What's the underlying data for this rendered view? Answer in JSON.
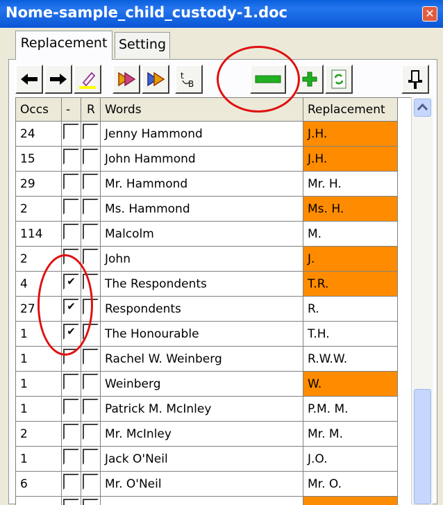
{
  "window": {
    "title": "Nome-sample_child_custody-1.doc",
    "close_glyph": "✕"
  },
  "tabs": [
    {
      "label": "Replacement",
      "active": true
    },
    {
      "label": "Setting",
      "active": false
    }
  ],
  "toolbar": {
    "buttons": [
      {
        "name": "left-arrow-icon"
      },
      {
        "name": "right-arrow-icon"
      },
      {
        "name": "highlighter-icon"
      },
      {
        "name": "replace-all-icon"
      },
      {
        "name": "restore-icon"
      },
      {
        "name": "case-icon"
      },
      {
        "name": "remove-icon"
      },
      {
        "name": "add-icon"
      },
      {
        "name": "refresh-icon"
      },
      {
        "name": "pin-icon"
      }
    ]
  },
  "table": {
    "headers": {
      "occs": "Occs",
      "minus": "-",
      "r": "R",
      "words": "Words",
      "replacement": "Replacement"
    },
    "rows": [
      {
        "occs": "24",
        "minus": false,
        "r": false,
        "word": "Jenny Hammond",
        "replacement": "J.H.",
        "highlight": true
      },
      {
        "occs": "15",
        "minus": false,
        "r": false,
        "word": "John Hammond",
        "replacement": "J.H.",
        "highlight": true
      },
      {
        "occs": "29",
        "minus": false,
        "r": false,
        "word": "Mr. Hammond",
        "replacement": "Mr. H.",
        "highlight": false
      },
      {
        "occs": "2",
        "minus": false,
        "r": false,
        "word": "Ms. Hammond",
        "replacement": "Ms. H.",
        "highlight": true
      },
      {
        "occs": "114",
        "minus": false,
        "r": false,
        "word": "Malcolm",
        "replacement": "M.",
        "highlight": false
      },
      {
        "occs": "2",
        "minus": false,
        "r": false,
        "word": "John",
        "replacement": "J.",
        "highlight": true
      },
      {
        "occs": "4",
        "minus": true,
        "r": false,
        "word": "The Respondents",
        "replacement": "T.R.",
        "highlight": true
      },
      {
        "occs": "27",
        "minus": true,
        "r": false,
        "word": "Respondents",
        "replacement": "R.",
        "highlight": false
      },
      {
        "occs": "1",
        "minus": true,
        "r": false,
        "word": "The Honourable",
        "replacement": "T.H.",
        "highlight": false
      },
      {
        "occs": "1",
        "minus": false,
        "r": false,
        "word": "Rachel W. Weinberg",
        "replacement": "R.W.W.",
        "highlight": false
      },
      {
        "occs": "1",
        "minus": false,
        "r": false,
        "word": "Weinberg",
        "replacement": "W.",
        "highlight": true
      },
      {
        "occs": "1",
        "minus": false,
        "r": false,
        "word": "Patrick M. McInley",
        "replacement": "P.M. M.",
        "highlight": false
      },
      {
        "occs": "2",
        "minus": false,
        "r": false,
        "word": "Mr. McInley",
        "replacement": "Mr. M.",
        "highlight": false
      },
      {
        "occs": "1",
        "minus": false,
        "r": false,
        "word": "Jack O'Neil",
        "replacement": "J.O.",
        "highlight": false
      },
      {
        "occs": "6",
        "minus": false,
        "r": false,
        "word": "Mr. O'Neil",
        "replacement": "Mr. O.",
        "highlight": false
      },
      {
        "occs": "",
        "minus": false,
        "r": false,
        "word": "",
        "replacement": "",
        "highlight": true
      }
    ]
  },
  "colors": {
    "highlight": "#ff8c00",
    "annotation": "#e01010",
    "title_bar": "#0a5fdc"
  },
  "check_glyph": "✔"
}
